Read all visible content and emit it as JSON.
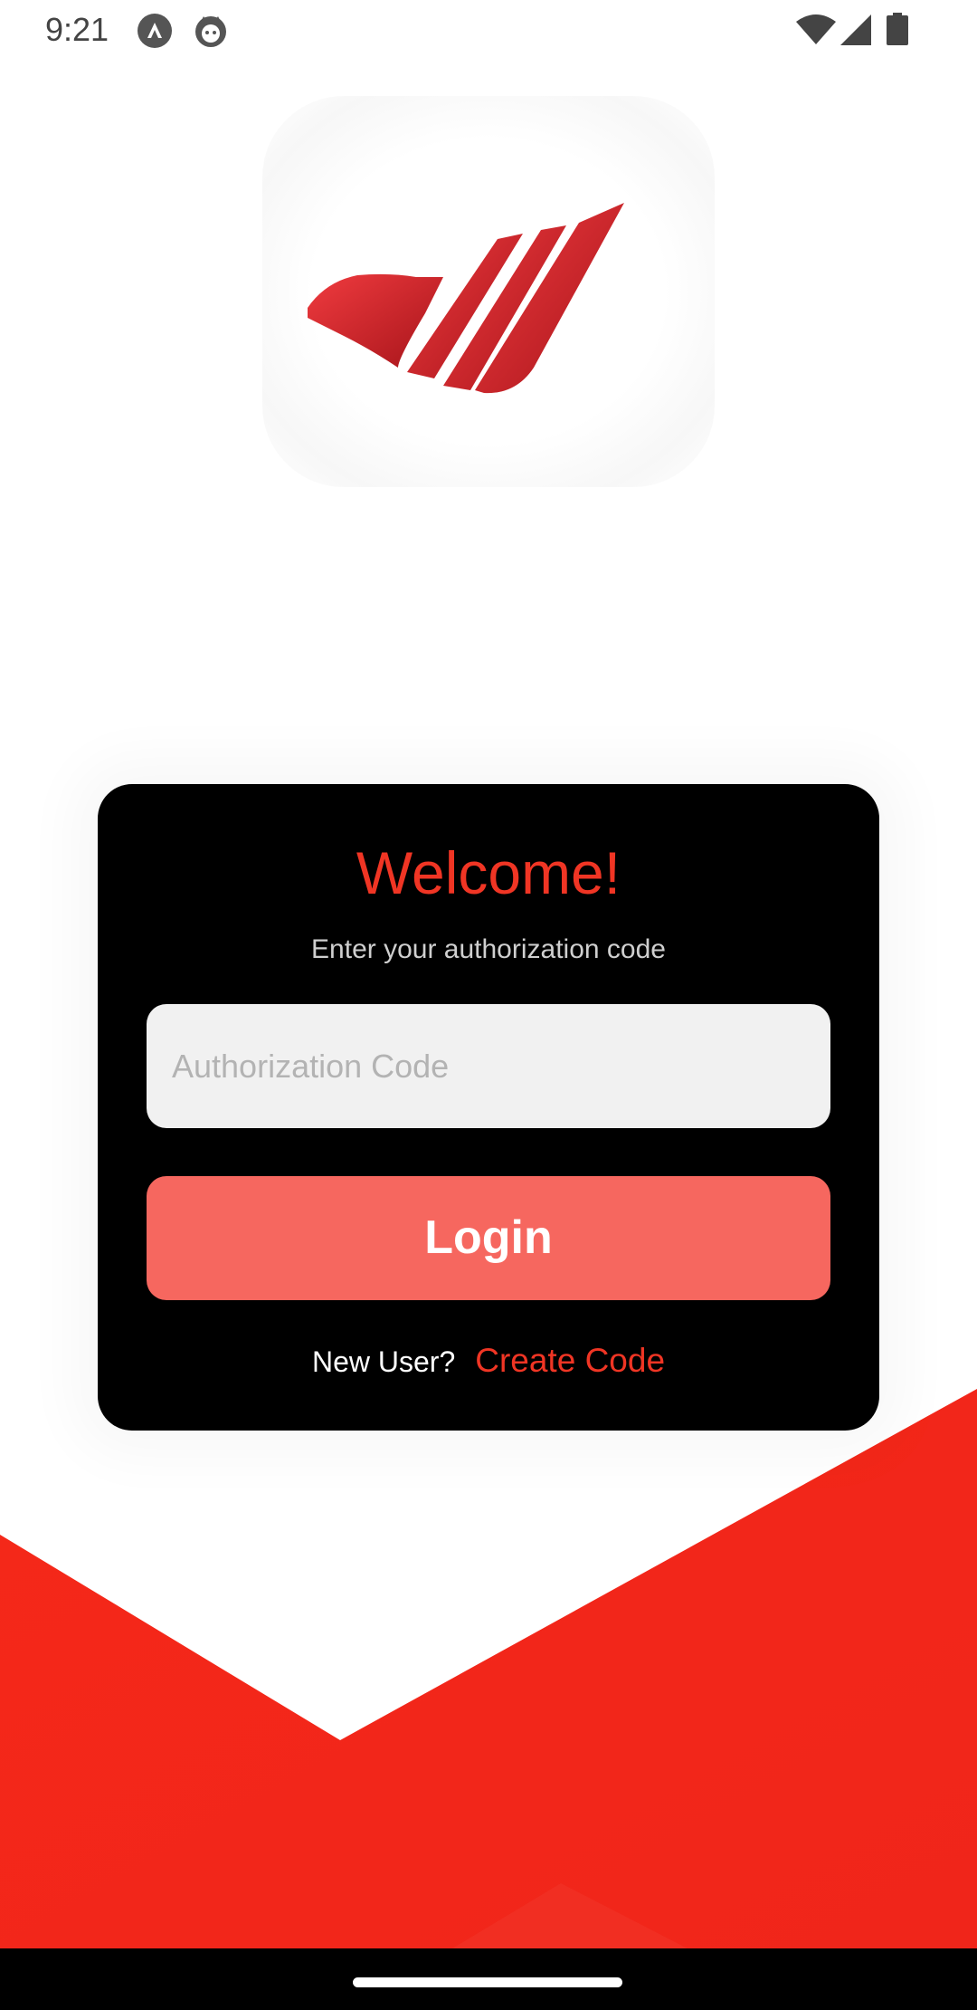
{
  "status_bar": {
    "time": "9:21",
    "icons": [
      "app-notification-icon",
      "cat-notification-icon",
      "wifi-icon",
      "cell-signal-icon",
      "battery-icon"
    ]
  },
  "logo": {
    "icon": "brand-logo-icon",
    "colors": {
      "primary": "#e3202a",
      "dark": "#a8141b"
    }
  },
  "login_card": {
    "title": "Welcome!",
    "subtitle": "Enter your authorization code",
    "auth_input": {
      "placeholder": "Authorization Code",
      "value": ""
    },
    "login_button_label": "Login",
    "new_user_label": "New User?",
    "create_code_link": "Create Code"
  },
  "theme": {
    "accent": "#f03524",
    "button": "#f6675f",
    "card_bg": "#000000",
    "background_red": "#f52819"
  }
}
